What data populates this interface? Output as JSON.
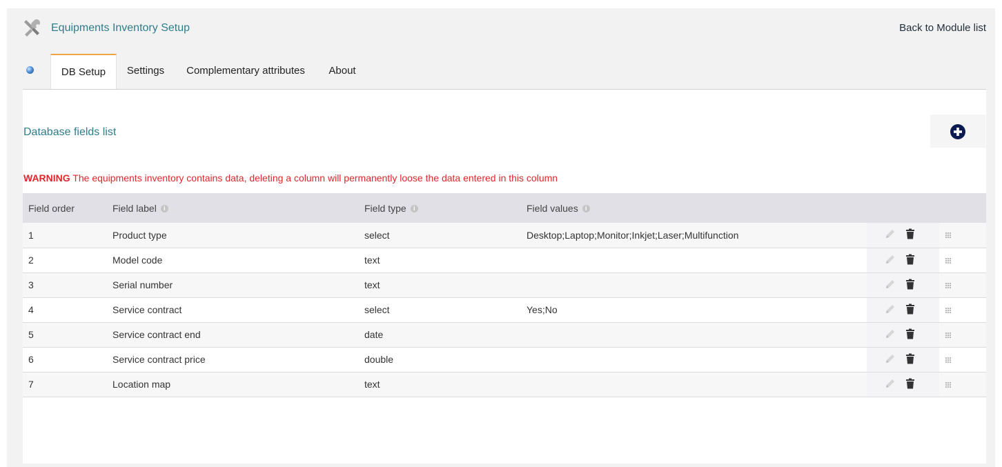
{
  "header": {
    "app_title": "Equipments Inventory Setup",
    "back_link": "Back to Module list",
    "icon": "tools-icon"
  },
  "tabs": [
    {
      "label": "DB Setup",
      "active": true
    },
    {
      "label": "Settings",
      "active": false
    },
    {
      "label": "Complementary attributes",
      "active": false
    },
    {
      "label": "About",
      "active": false
    }
  ],
  "section": {
    "title": "Database fields list",
    "add_icon": "plus-circle-icon"
  },
  "warning": {
    "label": "WARNING",
    "text": " The equipments inventory contains data, deleting a column will permanently loose the data entered in this column"
  },
  "table": {
    "headers": [
      "Field order",
      "Field label",
      "Field type",
      "Field values"
    ],
    "rows": [
      {
        "order": "1",
        "label": "Product type",
        "type": "select",
        "values": "Desktop;Laptop;Monitor;Inkjet;Laser;Multifunction"
      },
      {
        "order": "2",
        "label": "Model code",
        "type": "text",
        "values": ""
      },
      {
        "order": "3",
        "label": "Serial number",
        "type": "text",
        "values": ""
      },
      {
        "order": "4",
        "label": "Service contract",
        "type": "select",
        "values": "Yes;No"
      },
      {
        "order": "5",
        "label": "Service contract end",
        "type": "date",
        "values": ""
      },
      {
        "order": "6",
        "label": "Service contract price",
        "type": "double",
        "values": ""
      },
      {
        "order": "7",
        "label": "Location map",
        "type": "text",
        "values": ""
      }
    ]
  },
  "colors": {
    "accent": "#2e7d8a",
    "warning": "#e0262b",
    "tab_active_border": "#f0a545",
    "add_button": "#0b1a4f"
  }
}
